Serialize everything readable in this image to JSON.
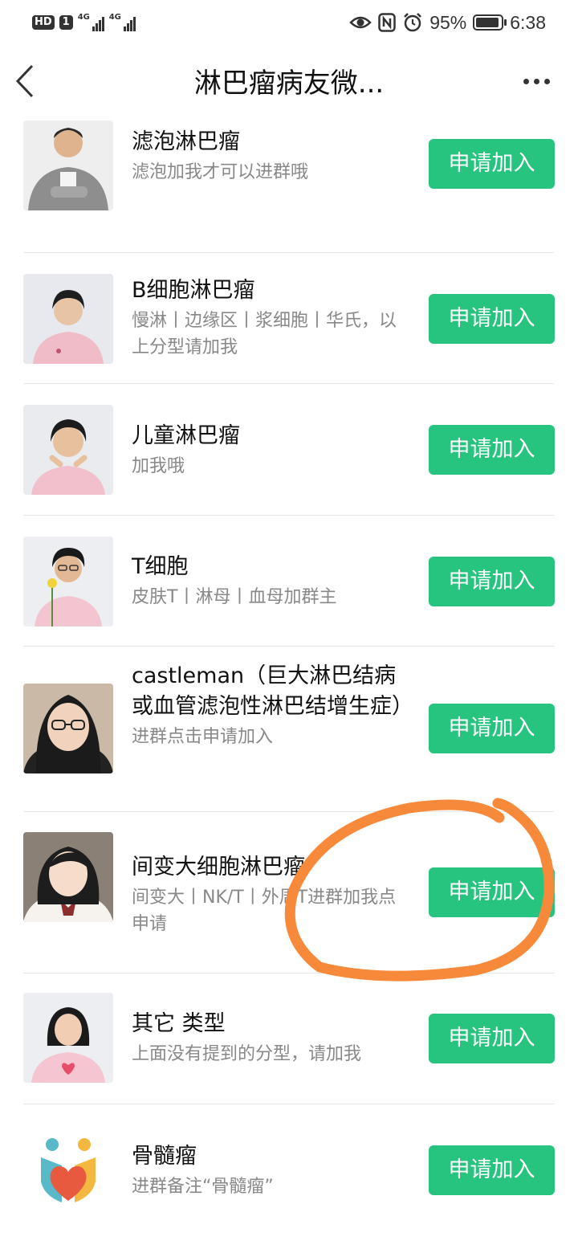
{
  "status_bar": {
    "hd_label": "HD",
    "sim_label": "1",
    "net1": "4G",
    "net2": "4G",
    "battery_percent": "95%",
    "time": "6:38",
    "battery_level": 0.95
  },
  "nav": {
    "title": "淋巴瘤病友微..."
  },
  "join_label": "申请加入",
  "accent_color": "#26c47e",
  "annotation_color": "#f7893a",
  "groups": [
    {
      "name": "滤泡淋巴瘤",
      "desc": "滤泡加我才可以进群哦",
      "avatar": "man-gray-tshirt"
    },
    {
      "name": "B细胞淋巴瘤",
      "desc": "慢淋丨边缘区丨浆细胞丨华氏，以上分型请加我",
      "avatar": "woman-pink-top"
    },
    {
      "name": "儿童淋巴瘤",
      "desc": "加我哦",
      "avatar": "woman-hands-chin"
    },
    {
      "name": "T细胞",
      "desc": "皮肤T丨淋母丨血母加群主",
      "avatar": "woman-glasses-flower"
    },
    {
      "name": "castleman（巨大淋巴结病或血管滤泡性淋巴结增生症）",
      "desc": "进群点击申请加入",
      "avatar": "woman-glasses-selfie"
    },
    {
      "name": "间变大细胞淋巴瘤",
      "desc": "间变大丨NK/T丨外周T进群加我点申请",
      "avatar": "woman-school-uniform"
    },
    {
      "name": "其它 类型",
      "desc": "上面没有提到的分型，请加我",
      "avatar": "woman-heart-hands"
    },
    {
      "name": "骨髓瘤",
      "desc": "进群备注“骨髓瘤”",
      "avatar": "heart-logo"
    }
  ]
}
